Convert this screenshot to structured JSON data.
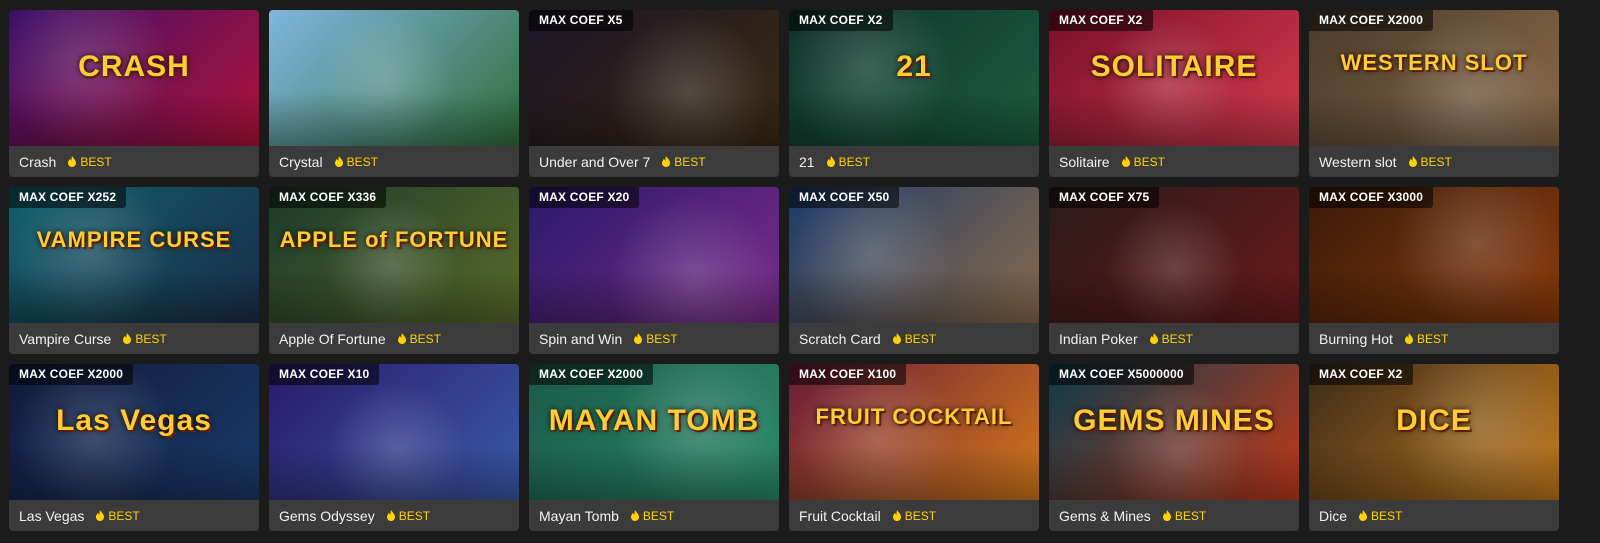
{
  "badge_label": "BEST",
  "colors": {
    "card_footer": "#3b3b3b",
    "badge": "#ffd200",
    "page_bg": "#1b1b1b"
  },
  "games": [
    {
      "name": "Crash",
      "coef": "",
      "logo": "CRASH",
      "theme": [
        "#3a0f6a",
        "#b0123a"
      ]
    },
    {
      "name": "Crystal",
      "coef": "",
      "logo": "",
      "theme": [
        "#7fb7e0",
        "#2f6e3a"
      ]
    },
    {
      "name": "Under and Over 7",
      "coef": "MAX COEF X5",
      "logo": "",
      "theme": [
        "#1c1426",
        "#3a2a12"
      ]
    },
    {
      "name": "21",
      "coef": "MAX COEF X2",
      "logo": "21",
      "theme": [
        "#0f2f2a",
        "#1b5e3f"
      ]
    },
    {
      "name": "Solitaire",
      "coef": "MAX COEF X2",
      "logo": "SOLITAIRE",
      "theme": [
        "#7a0f2a",
        "#d43a4a"
      ]
    },
    {
      "name": "Western slot",
      "coef": "MAX COEF X2000",
      "logo": "WESTERN SLOT",
      "theme": [
        "#4a3a2a",
        "#8a6a4a"
      ]
    },
    {
      "name": "Vampire Curse",
      "coef": "MAX COEF X252",
      "logo": "VAMPIRE CURSE",
      "theme": [
        "#0f5f6a",
        "#1a2e4a"
      ]
    },
    {
      "name": "Apple Of Fortune",
      "coef": "MAX COEF X336",
      "logo": "APPLE of FORTUNE",
      "theme": [
        "#1a3a2a",
        "#5a6a2a"
      ]
    },
    {
      "name": "Spin and Win",
      "coef": "MAX COEF X20",
      "logo": "",
      "theme": [
        "#2a1a6a",
        "#7a2a8a"
      ]
    },
    {
      "name": "Scratch Card",
      "coef": "MAX COEF X50",
      "logo": "",
      "theme": [
        "#1a3a6a",
        "#8a6a4a"
      ]
    },
    {
      "name": "Indian Poker",
      "coef": "MAX COEF X75",
      "logo": "",
      "theme": [
        "#2a1a1a",
        "#6a1a1a"
      ]
    },
    {
      "name": "Burning Hot",
      "coef": "MAX COEF X3000",
      "logo": "",
      "theme": [
        "#3a1a0a",
        "#8a3a0a"
      ]
    },
    {
      "name": "Las Vegas",
      "coef": "MAX COEF X2000",
      "logo": "Las Vegas",
      "theme": [
        "#0f1a3a",
        "#1a3a6a"
      ]
    },
    {
      "name": "Gems Odyssey",
      "coef": "MAX COEF X10",
      "logo": "",
      "theme": [
        "#2a1a6a",
        "#3a5aaa"
      ]
    },
    {
      "name": "Mayan Tomb",
      "coef": "MAX COEF X2000",
      "logo": "MAYAN TOMB",
      "theme": [
        "#1a5a4a",
        "#2a8a6a"
      ]
    },
    {
      "name": "Fruit Cocktail",
      "coef": "MAX COEF X100",
      "logo": "FRUIT COCKTAIL",
      "theme": [
        "#6a1a3a",
        "#d47a1a"
      ]
    },
    {
      "name": "Gems & Mines",
      "coef": "MAX COEF X5000000",
      "logo": "GEMS MINES",
      "theme": [
        "#0a3a4a",
        "#c43a1a"
      ]
    },
    {
      "name": "Dice",
      "coef": "MAX COEF X2",
      "logo": "DICE",
      "theme": [
        "#3a2a1a",
        "#c47a1a"
      ]
    }
  ]
}
